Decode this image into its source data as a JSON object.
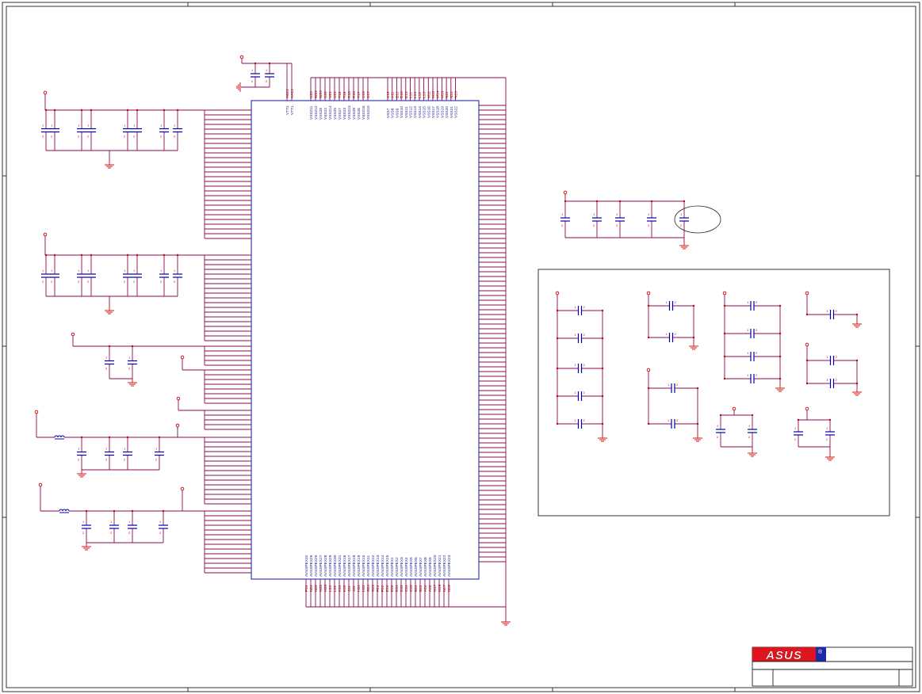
{
  "title_block": {
    "logo_text": "ASUS",
    "logo_mark": "®"
  },
  "chip": {
    "vtt_pins": [
      {
        "name": "VTT2",
        "number": "AB22"
      },
      {
        "name": "VTT1",
        "number": "AA21"
      }
    ],
    "top_pins_a": [
      {
        "name": "VSS211",
        "number": "U23"
      },
      {
        "name": "VSS212",
        "number": "W22"
      },
      {
        "name": "VSS29",
        "number": "W20"
      },
      {
        "name": "VSS24",
        "number": "V20"
      },
      {
        "name": "VSS214",
        "number": "V21"
      },
      {
        "name": "VSS25",
        "number": "U21"
      },
      {
        "name": "VSS27",
        "number": "T16"
      },
      {
        "name": "VSS23",
        "number": "T18"
      },
      {
        "name": "VSS213",
        "number": "R18"
      },
      {
        "name": "VSS28",
        "number": "R16"
      },
      {
        "name": "VSS26",
        "number": "T17"
      },
      {
        "name": "VSS215",
        "number": "U18"
      },
      {
        "name": "VSS210",
        "number": "U17"
      }
    ],
    "top_pins_b": [
      {
        "name": "VSS7",
        "number": "A19"
      },
      {
        "name": "VSS8",
        "number": "A11"
      },
      {
        "name": "VSS9",
        "number": "B12"
      },
      {
        "name": "VSS10",
        "number": "D10"
      },
      {
        "name": "VSS11",
        "number": "E13"
      },
      {
        "name": "VSS12",
        "number": "L11"
      },
      {
        "name": "VSS13",
        "number": "L14"
      },
      {
        "name": "VSS14",
        "number": "L12"
      },
      {
        "name": "VSS15",
        "number": "L13"
      },
      {
        "name": "VSS16",
        "number": "M11"
      },
      {
        "name": "VSS17",
        "number": "M12"
      },
      {
        "name": "VSS18",
        "number": "M14"
      },
      {
        "name": "VSS19",
        "number": "M13"
      },
      {
        "name": "VSS20",
        "number": "N11"
      },
      {
        "name": "VSS21",
        "number": "N14"
      },
      {
        "name": "VSS22",
        "number": "N13"
      }
    ],
    "bottom_pins": [
      {
        "name": "AVSSPEX32",
        "number": "P24"
      },
      {
        "name": "AVSSPEX26",
        "number": "N24"
      },
      {
        "name": "AVSSPEX25",
        "number": "N22"
      },
      {
        "name": "AVSSPEX27",
        "number": "M22"
      },
      {
        "name": "AVSSPEX28",
        "number": "M20"
      },
      {
        "name": "AVSSPEX29",
        "number": "L24"
      },
      {
        "name": "AVSSPEX30",
        "number": "L22"
      },
      {
        "name": "AVSSPEX31",
        "number": "K24"
      },
      {
        "name": "AVSSPEX16",
        "number": "K22"
      },
      {
        "name": "AVSSPEX17",
        "number": "J24"
      },
      {
        "name": "AVSSPEX18",
        "number": "J22"
      },
      {
        "name": "AVSSPEX19",
        "number": "H24"
      },
      {
        "name": "AVSSPEX10",
        "number": "H22"
      },
      {
        "name": "AVSSPEX11",
        "number": "G24"
      },
      {
        "name": "AVSSPEX12",
        "number": "G22"
      },
      {
        "name": "AVSSPEX13",
        "number": "F24"
      },
      {
        "name": "AVSSPEX14",
        "number": "F22"
      },
      {
        "name": "AVSSPEX15",
        "number": "E24"
      },
      {
        "name": "AVSSPEX1",
        "number": "E22"
      },
      {
        "name": "AVSSPEX2",
        "number": "D24"
      },
      {
        "name": "AVSSPEX3",
        "number": "D22"
      },
      {
        "name": "AVSSPEX4",
        "number": "C24"
      },
      {
        "name": "AVSSPEX5",
        "number": "C22"
      },
      {
        "name": "AVSSPEX6",
        "number": "B24"
      },
      {
        "name": "AVSSPEX7",
        "number": "B22"
      },
      {
        "name": "AVSSPEX8",
        "number": "A24"
      },
      {
        "name": "AVSSPEX9",
        "number": "A22"
      },
      {
        "name": "AVSSPEX20",
        "number": "M17"
      },
      {
        "name": "AVSSPEX21",
        "number": "M19"
      },
      {
        "name": "AVSSPEX22",
        "number": "N17"
      },
      {
        "name": "AVSSPEX23",
        "number": "N19"
      }
    ]
  },
  "component_pin_labels": [
    "1",
    "2"
  ],
  "colors": {
    "wire": "#8a0b52",
    "power": "#cc0000",
    "capacitor": "#0000aa",
    "chip_outline": "#2a2ab0",
    "pin_name": "#1a1a9a",
    "pin_number": "#990000",
    "frame": "#333333",
    "logo_red": "#e0141e",
    "logo_blue": "#1a2aa8"
  }
}
